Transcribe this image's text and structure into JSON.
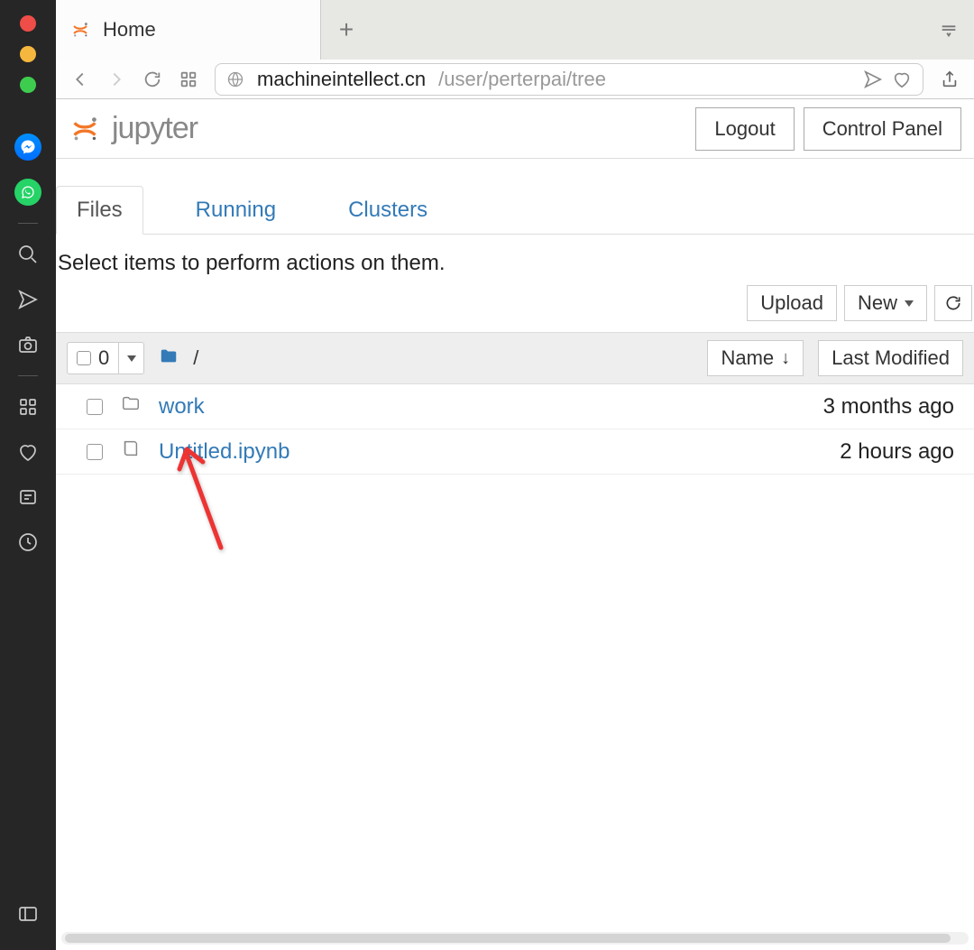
{
  "browser": {
    "tab_title": "Home",
    "url_host": "machineintellect.cn",
    "url_path": "/user/perterpai/tree"
  },
  "header": {
    "logo_text": "jupyter",
    "logout": "Logout",
    "control_panel": "Control Panel"
  },
  "tabs": {
    "files": "Files",
    "running": "Running",
    "clusters": "Clusters"
  },
  "hint": "Select items to perform actions on them.",
  "toolbar": {
    "upload": "Upload",
    "new": "New"
  },
  "listhead": {
    "selected_count": "0",
    "breadcrumb_separator": "/",
    "sort_name": "Name",
    "sort_modified": "Last Modified"
  },
  "rows": [
    {
      "type": "folder",
      "name": "work",
      "modified": "3 months ago"
    },
    {
      "type": "notebook",
      "name": "Untitled.ipynb",
      "modified": "2 hours ago"
    }
  ]
}
